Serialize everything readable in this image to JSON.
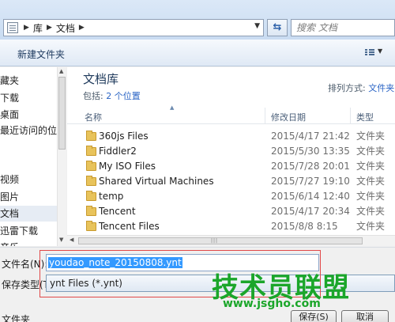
{
  "address_bar": {
    "crumbs": [
      "库",
      "文档"
    ],
    "search_placeholder": "搜索 文档"
  },
  "toolbar": {
    "new_folder_label": "新建文件夹"
  },
  "nav": {
    "items": [
      "藏夹",
      "下载",
      "桌面",
      "最近访问的位置",
      "视频",
      "图片",
      "文档",
      "迅雷下载",
      "音乐"
    ],
    "selected_index": 6
  },
  "library": {
    "title": "文档库",
    "include_label": "包括:",
    "include_link": "2 个位置",
    "sort_label": "排列方式:",
    "sort_value": "文件夹"
  },
  "columns": {
    "name": "名称",
    "modified": "修改日期",
    "type": "类型"
  },
  "files": [
    {
      "name": "360js Files",
      "date": "2015/4/17 21:42",
      "type": "文件夹"
    },
    {
      "name": "Fiddler2",
      "date": "2015/5/30 13:35",
      "type": "文件夹"
    },
    {
      "name": "My ISO Files",
      "date": "2015/7/28 20:01",
      "type": "文件夹"
    },
    {
      "name": "Shared Virtual Machines",
      "date": "2015/7/27 19:10",
      "type": "文件夹"
    },
    {
      "name": "temp",
      "date": "2015/6/14 12:40",
      "type": "文件夹"
    },
    {
      "name": "Tencent",
      "date": "2015/4/17 20:34",
      "type": "文件夹"
    },
    {
      "name": "Tencent Files",
      "date": "2015/8/8 8:15",
      "type": "文件夹"
    }
  ],
  "save_form": {
    "filename_label": "文件名(N):",
    "filename_value": "youdao_note_20150808.ynt",
    "filetype_label": "保存类型(T):",
    "filetype_value": "ynt Files (*.ynt)",
    "hide_folders_label": "文件夹",
    "save_button": "保存(S)",
    "cancel_button": "取消"
  },
  "watermark": {
    "text": "技术员联盟",
    "url": "www.jsgho.com"
  },
  "colors": {
    "selection": "#3399ff",
    "highlight_box": "#e04848",
    "watermark": "#1ba62a",
    "title_blue": "#1e395b"
  }
}
